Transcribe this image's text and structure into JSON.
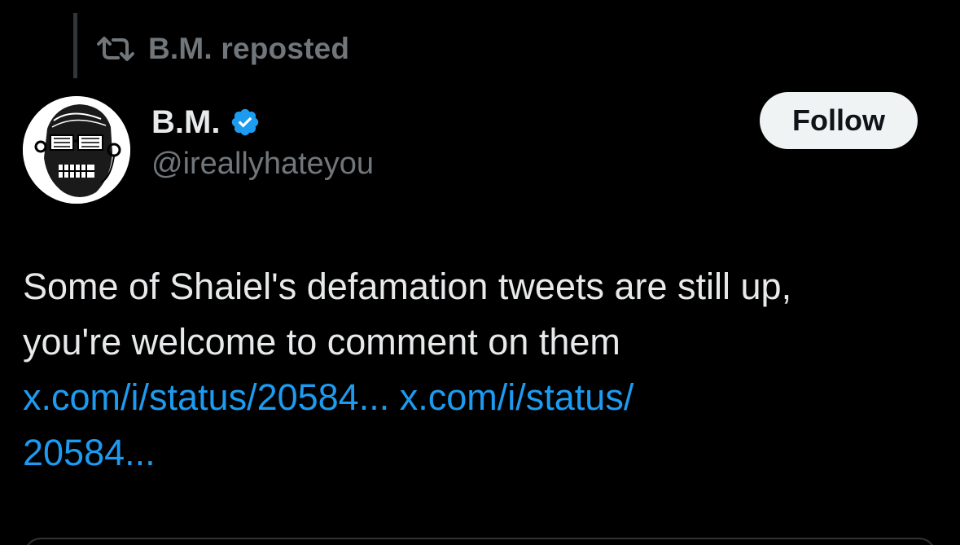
{
  "repost": {
    "label": "B.M. reposted",
    "icon": "repost-icon"
  },
  "author": {
    "display_name": "B.M.",
    "handle": "@ireallyhateyou",
    "verified": true,
    "verified_color": "#1d9bf0",
    "avatar": "avatar-image"
  },
  "follow_button": {
    "label": "Follow"
  },
  "tweet": {
    "line1": "Some of Shaiel's defamation tweets are still up,",
    "line2": "you're welcome to comment on them",
    "link1": "x.com/i/status/20584...",
    "link2_part1": "x.com/i/status/",
    "link2_part2": "20584..."
  },
  "colors": {
    "background": "#000000",
    "text_primary": "#e7e9ea",
    "text_secondary": "#71767b",
    "link": "#1d9bf0",
    "button_bg": "#eff3f4"
  }
}
